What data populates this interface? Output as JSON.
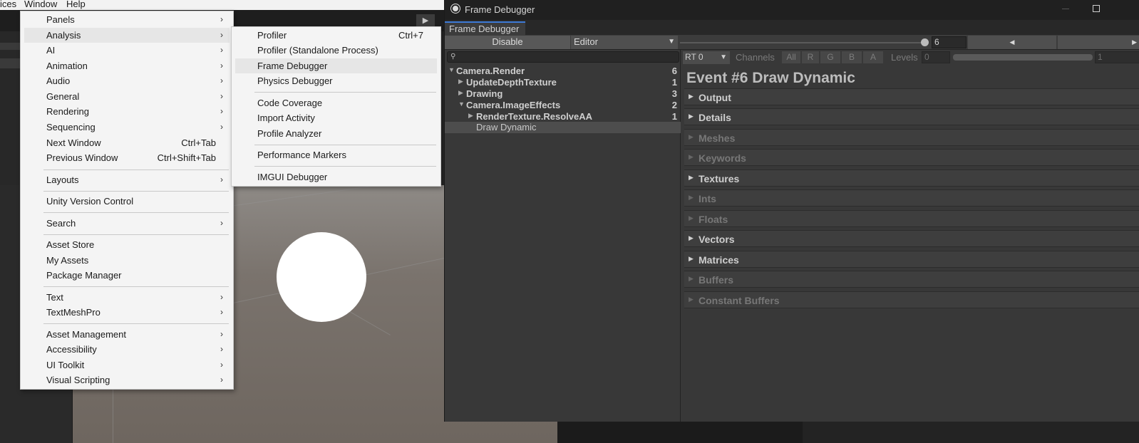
{
  "menubar": {
    "items": [
      "ices",
      "Window",
      "Help"
    ]
  },
  "editor": {
    "play_glyph": "▶"
  },
  "main_menu": {
    "items": [
      {
        "label": "Panels",
        "submenu": true
      },
      {
        "label": "Analysis",
        "submenu": true
      },
      {
        "label": "AI",
        "submenu": true
      },
      {
        "label": "Animation",
        "submenu": true
      },
      {
        "label": "Audio",
        "submenu": true
      },
      {
        "label": "General",
        "submenu": true
      },
      {
        "label": "Rendering",
        "submenu": true
      },
      {
        "label": "Sequencing",
        "submenu": true
      },
      {
        "label": "Next Window",
        "shortcut": "Ctrl+Tab"
      },
      {
        "label": "Previous Window",
        "shortcut": "Ctrl+Shift+Tab"
      },
      {
        "label": "Layouts",
        "submenu": true
      },
      {
        "label": "Unity Version Control"
      },
      {
        "label": "Search",
        "submenu": true
      },
      {
        "label": "Asset Store"
      },
      {
        "label": "My Assets"
      },
      {
        "label": "Package Manager"
      },
      {
        "label": "Text",
        "submenu": true
      },
      {
        "label": "TextMeshPro",
        "submenu": true
      },
      {
        "label": "Asset Management",
        "submenu": true
      },
      {
        "label": "Accessibility",
        "submenu": true
      },
      {
        "label": "UI Toolkit",
        "submenu": true
      },
      {
        "label": "Visual Scripting",
        "submenu": true
      }
    ]
  },
  "analysis_submenu": {
    "items": [
      {
        "label": "Profiler",
        "shortcut": "Ctrl+7"
      },
      {
        "label": "Profiler (Standalone Process)"
      },
      {
        "label": "Frame Debugger"
      },
      {
        "label": "Physics Debugger"
      },
      {
        "label": "Code Coverage"
      },
      {
        "label": "Import Activity"
      },
      {
        "label": "Profile Analyzer"
      },
      {
        "label": "Performance Markers"
      },
      {
        "label": "IMGUI Debugger"
      }
    ]
  },
  "frame_debugger": {
    "window_title": "Frame Debugger",
    "tab_label": "Frame Debugger",
    "disable_label": "Disable",
    "target_label": "Editor",
    "event_index": "6",
    "slider_fraction": 1.0,
    "tree": [
      {
        "label": "Camera.Render",
        "count": "6",
        "expanded": true
      },
      {
        "label": "UpdateDepthTexture",
        "count": "1",
        "expanded": false
      },
      {
        "label": "Drawing",
        "count": "3",
        "expanded": false
      },
      {
        "label": "Camera.ImageEffects",
        "count": "2",
        "expanded": true
      },
      {
        "label": "RenderTexture.ResolveAA",
        "count": "1",
        "expanded": false
      },
      {
        "label": "Draw Dynamic",
        "count": "",
        "selected": true
      }
    ],
    "rt_select": "RT 0",
    "channels_label": "Channels",
    "channels": [
      "All",
      "R",
      "G",
      "B",
      "A"
    ],
    "levels_label": "Levels",
    "levels_min": "0",
    "levels_max": "1",
    "event_title": "Event #6 Draw Dynamic",
    "sections": [
      {
        "label": "Output",
        "enabled": true
      },
      {
        "label": "Details",
        "enabled": true
      },
      {
        "label": "Meshes",
        "enabled": false
      },
      {
        "label": "Keywords",
        "enabled": false
      },
      {
        "label": "Textures",
        "enabled": true
      },
      {
        "label": "Ints",
        "enabled": false
      },
      {
        "label": "Floats",
        "enabled": false
      },
      {
        "label": "Vectors",
        "enabled": true
      },
      {
        "label": "Matrices",
        "enabled": true
      },
      {
        "label": "Buffers",
        "enabled": false
      },
      {
        "label": "Constant Buffers",
        "enabled": false
      }
    ]
  }
}
